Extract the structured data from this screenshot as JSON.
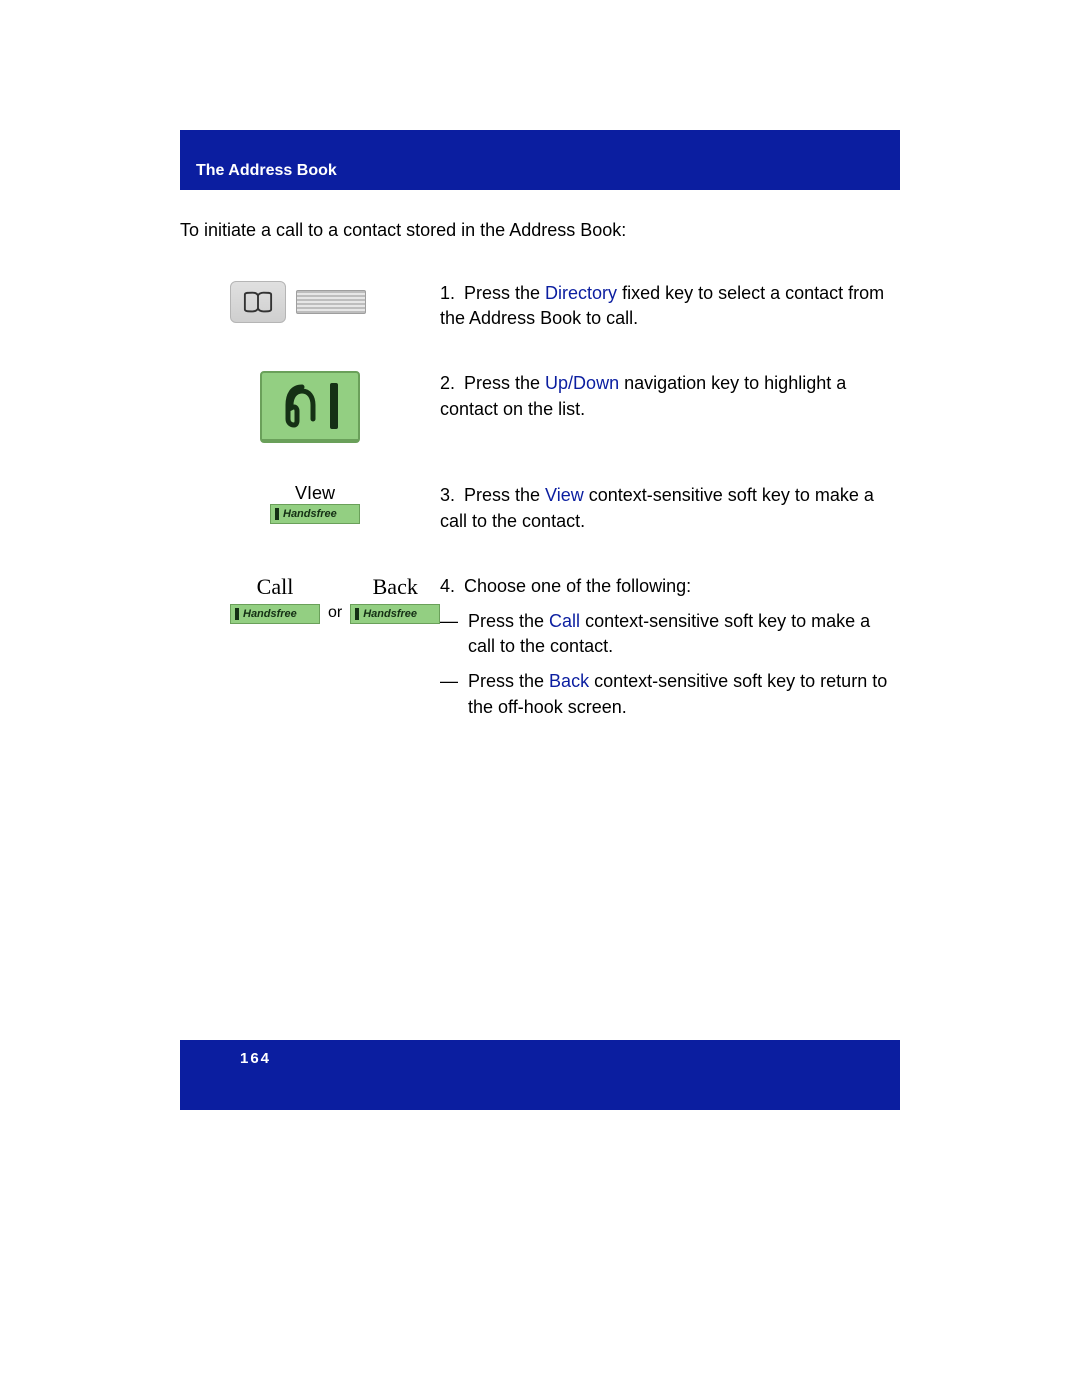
{
  "header": {
    "title": "The Address Book"
  },
  "intro": "To initiate a call to a contact stored in the Address Book:",
  "steps": {
    "s1": {
      "num": "1.",
      "pre": "Press the ",
      "term": "Directory",
      "post": "  fixed key to select a contact from the Address Book to call."
    },
    "s2": {
      "num": "2.",
      "pre": "Press the ",
      "term": "Up/Down",
      "post": "  navigation key to highlight a contact on the list."
    },
    "s3": {
      "num": "3.",
      "pre": "Press the ",
      "term": "View",
      "post": " context-sensitive soft key to make a call to the contact."
    },
    "s4": {
      "num": "4.",
      "lead": "Choose one of the following:",
      "a": {
        "dash": "—",
        "pre": "Press the ",
        "term": "Call",
        "post": " context-sensitive soft key to make a call to the contact."
      },
      "b": {
        "dash": "—",
        "pre": "Press the ",
        "term": "Back",
        "post": " context-sensitive soft key to return to the off-hook screen."
      }
    }
  },
  "labels": {
    "view": "VIew",
    "call": "Call",
    "back": "Back",
    "or": "or",
    "handsfree": "Handsfree"
  },
  "pagenum": "164"
}
